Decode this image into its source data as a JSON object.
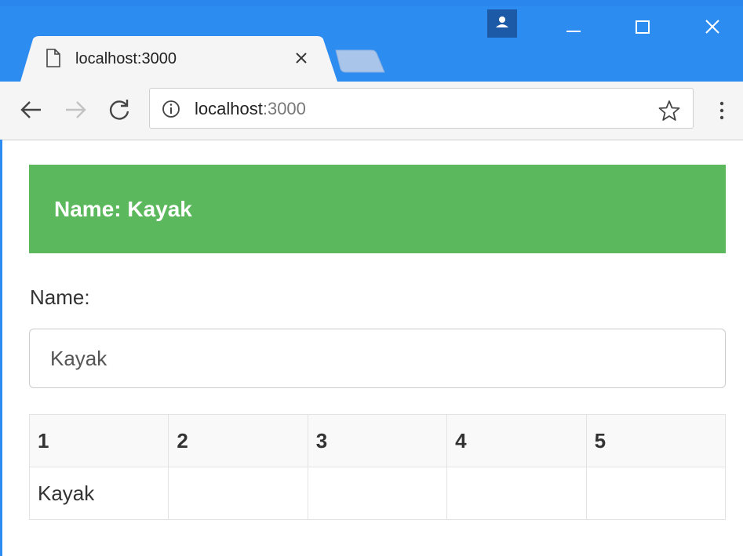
{
  "browser": {
    "tab_title": "localhost:3000",
    "url_host": "localhost",
    "url_port": ":3000",
    "icons": {
      "page": "page-icon",
      "close": "close-icon",
      "back": "back-arrow-icon",
      "forward": "forward-arrow-icon",
      "reload": "reload-icon",
      "info": "info-icon",
      "star": "star-icon",
      "menu": "menu-icon",
      "profile": "profile-icon",
      "minimize": "minimize-icon",
      "maximize": "maximize-icon"
    },
    "colors": {
      "titlebar": "#2d8cf0",
      "toolbar": "#f5f5f5"
    }
  },
  "page": {
    "banner_text": "Name: Kayak",
    "banner_color": "#5cb85c",
    "name_label": "Name:",
    "name_value": "Kayak",
    "table": {
      "headers": [
        "1",
        "2",
        "3",
        "4",
        "5"
      ],
      "rows": [
        [
          "Kayak",
          "",
          "",
          "",
          ""
        ]
      ]
    }
  }
}
